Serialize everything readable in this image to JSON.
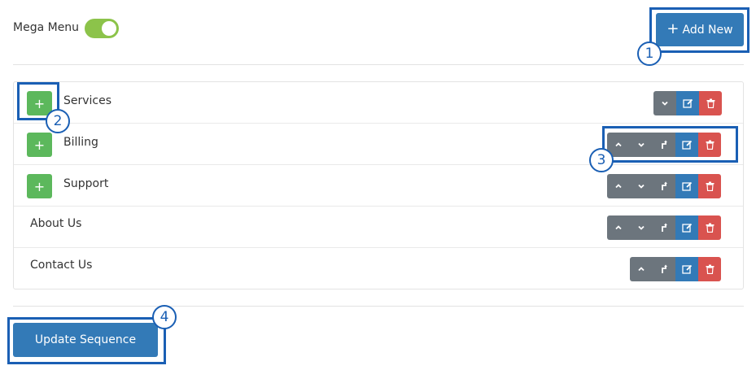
{
  "header": {
    "mega_menu_label": "Mega Menu",
    "mega_menu_enabled": true,
    "add_new_label": "Add New"
  },
  "menu_items": [
    {
      "label": "Services",
      "has_children_button": true
    },
    {
      "label": "Billing",
      "has_children_button": true
    },
    {
      "label": "Support",
      "has_children_button": true
    },
    {
      "label": "About Us",
      "has_children_button": false
    },
    {
      "label": "Contact Us",
      "has_children_button": false
    }
  ],
  "icons": {
    "expand": "plus-icon",
    "up": "chevron-up-icon",
    "down": "chevron-down-icon",
    "move": "move-out-icon",
    "edit": "edit-icon",
    "delete": "trash-icon"
  },
  "colors": {
    "primary": "#337ab7",
    "success": "#5cb85c",
    "danger": "#d9534f",
    "secondary": "#6c757d",
    "toggle_on": "#8cc34a",
    "callout": "#1a5fb4"
  },
  "footer": {
    "update_label": "Update Sequence"
  },
  "callouts": [
    "1",
    "2",
    "3",
    "4"
  ]
}
